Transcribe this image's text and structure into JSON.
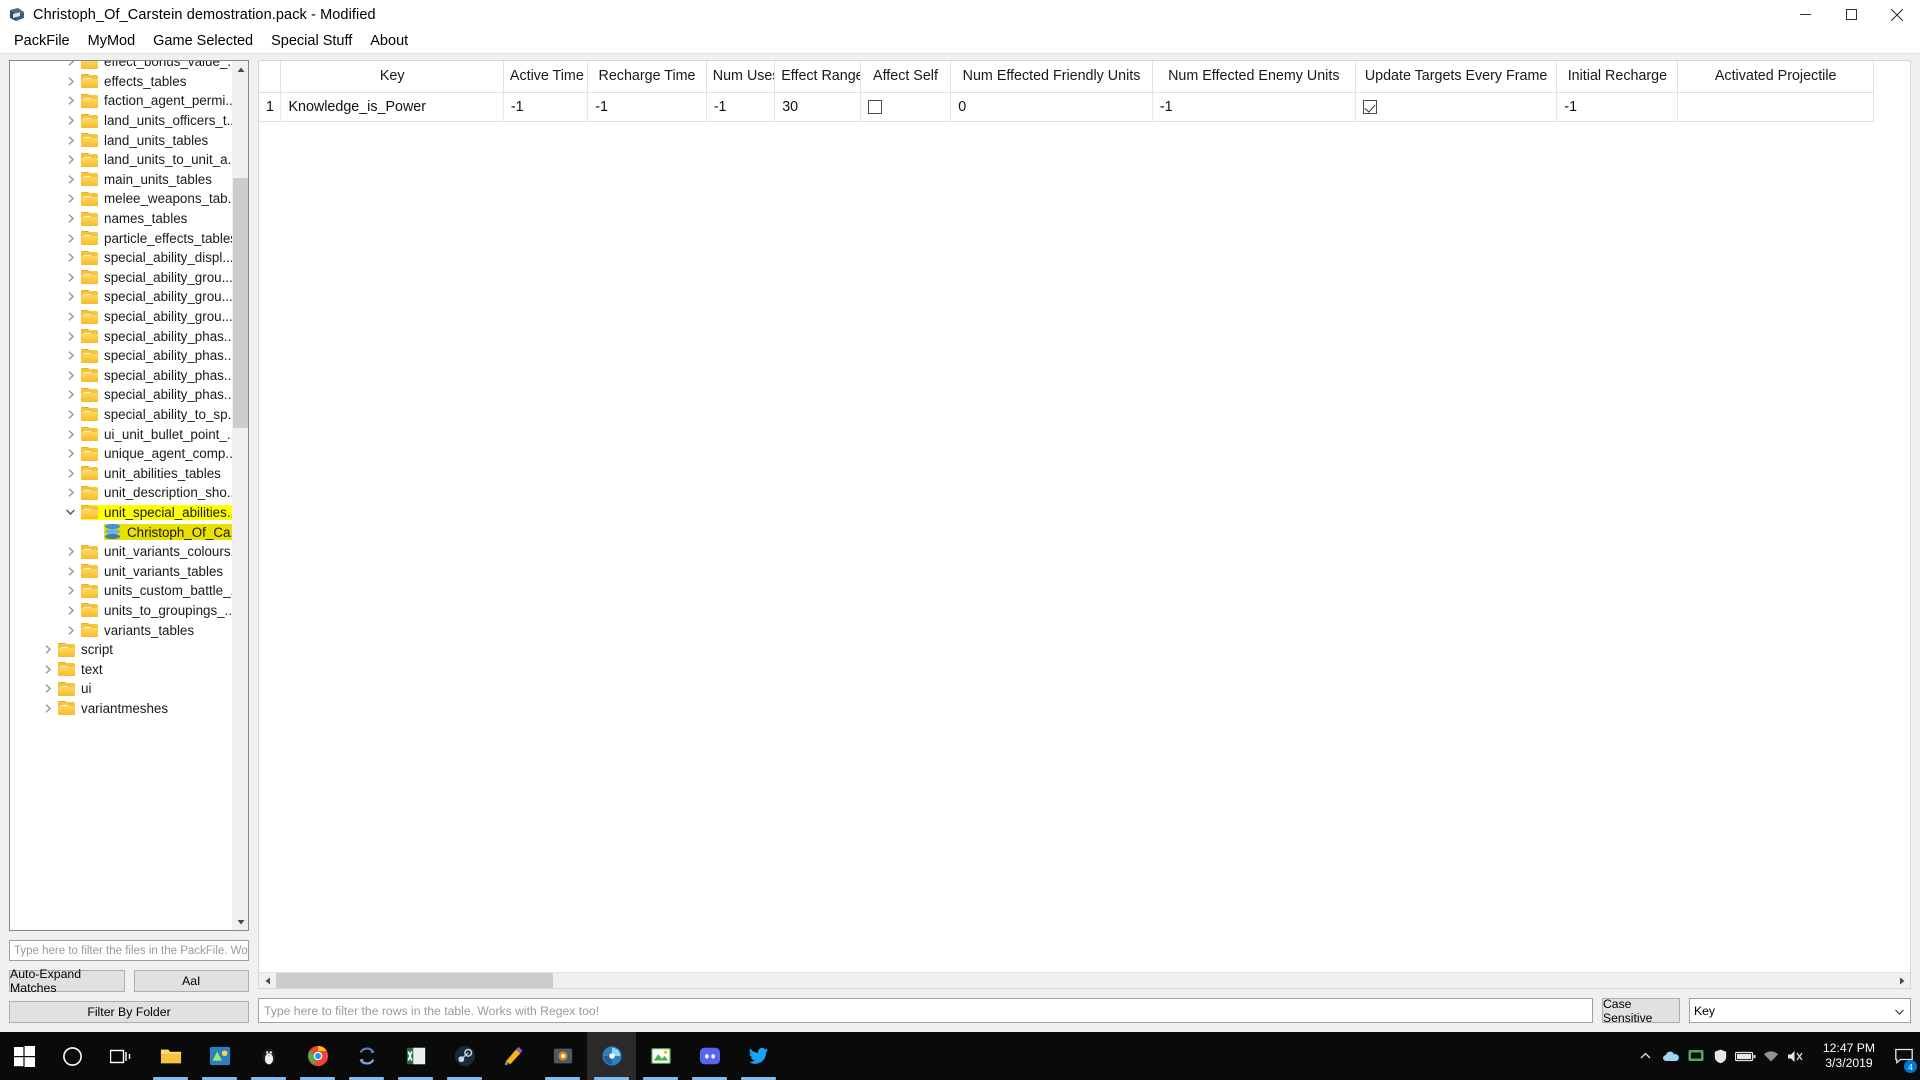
{
  "window": {
    "title": "Christoph_Of_Carstein demostration.pack - Modified",
    "icon": "packfile-manager-icon",
    "controls": {
      "minimize": "minimize-button",
      "maximize": "maximize-button",
      "close": "close-button"
    }
  },
  "menubar": {
    "items": [
      {
        "label": "PackFile"
      },
      {
        "label": "MyMod"
      },
      {
        "label": "Game Selected"
      },
      {
        "label": "Special Stuff"
      },
      {
        "label": "About"
      }
    ]
  },
  "tree": {
    "items": [
      {
        "label": "effect_bonus_value_...",
        "type": "folder",
        "indent": 1,
        "expander": "collapsed",
        "state": "normal"
      },
      {
        "label": "effects_tables",
        "type": "folder",
        "indent": 1,
        "expander": "collapsed",
        "state": "normal"
      },
      {
        "label": "faction_agent_permi...",
        "type": "folder",
        "indent": 1,
        "expander": "collapsed",
        "state": "normal"
      },
      {
        "label": "land_units_officers_t...",
        "type": "folder",
        "indent": 1,
        "expander": "collapsed",
        "state": "normal"
      },
      {
        "label": "land_units_tables",
        "type": "folder",
        "indent": 1,
        "expander": "collapsed",
        "state": "normal"
      },
      {
        "label": "land_units_to_unit_a...",
        "type": "folder",
        "indent": 1,
        "expander": "collapsed",
        "state": "normal"
      },
      {
        "label": "main_units_tables",
        "type": "folder",
        "indent": 1,
        "expander": "collapsed",
        "state": "normal"
      },
      {
        "label": "melee_weapons_tab...",
        "type": "folder",
        "indent": 1,
        "expander": "collapsed",
        "state": "normal"
      },
      {
        "label": "names_tables",
        "type": "folder",
        "indent": 1,
        "expander": "collapsed",
        "state": "normal"
      },
      {
        "label": "particle_effects_tables",
        "type": "folder",
        "indent": 1,
        "expander": "collapsed",
        "state": "normal"
      },
      {
        "label": "special_ability_displ...",
        "type": "folder",
        "indent": 1,
        "expander": "collapsed",
        "state": "normal"
      },
      {
        "label": "special_ability_grou...",
        "type": "folder",
        "indent": 1,
        "expander": "collapsed",
        "state": "normal"
      },
      {
        "label": "special_ability_grou...",
        "type": "folder",
        "indent": 1,
        "expander": "collapsed",
        "state": "normal"
      },
      {
        "label": "special_ability_grou...",
        "type": "folder",
        "indent": 1,
        "expander": "collapsed",
        "state": "normal"
      },
      {
        "label": "special_ability_phas...",
        "type": "folder",
        "indent": 1,
        "expander": "collapsed",
        "state": "normal"
      },
      {
        "label": "special_ability_phas...",
        "type": "folder",
        "indent": 1,
        "expander": "collapsed",
        "state": "normal"
      },
      {
        "label": "special_ability_phas...",
        "type": "folder",
        "indent": 1,
        "expander": "collapsed",
        "state": "normal"
      },
      {
        "label": "special_ability_phas...",
        "type": "folder",
        "indent": 1,
        "expander": "collapsed",
        "state": "normal"
      },
      {
        "label": "special_ability_to_sp...",
        "type": "folder",
        "indent": 1,
        "expander": "collapsed",
        "state": "normal"
      },
      {
        "label": "ui_unit_bullet_point_...",
        "type": "folder",
        "indent": 1,
        "expander": "collapsed",
        "state": "normal"
      },
      {
        "label": "unique_agent_comp...",
        "type": "folder",
        "indent": 1,
        "expander": "collapsed",
        "state": "normal"
      },
      {
        "label": "unit_abilities_tables",
        "type": "folder",
        "indent": 1,
        "expander": "collapsed",
        "state": "normal"
      },
      {
        "label": "unit_description_sho...",
        "type": "folder",
        "indent": 1,
        "expander": "collapsed",
        "state": "normal"
      },
      {
        "label": "unit_special_abilities...",
        "type": "folder",
        "indent": 1,
        "expander": "expanded",
        "state": "highlighted"
      },
      {
        "label": "Christoph_Of_Ca...",
        "type": "db",
        "indent": 2,
        "expander": "none",
        "state": "selected"
      },
      {
        "label": "unit_variants_colours...",
        "type": "folder",
        "indent": 1,
        "expander": "collapsed",
        "state": "normal"
      },
      {
        "label": "unit_variants_tables",
        "type": "folder",
        "indent": 1,
        "expander": "collapsed",
        "state": "normal"
      },
      {
        "label": "units_custom_battle_...",
        "type": "folder",
        "indent": 1,
        "expander": "collapsed",
        "state": "normal"
      },
      {
        "label": "units_to_groupings_...",
        "type": "folder",
        "indent": 1,
        "expander": "collapsed",
        "state": "normal"
      },
      {
        "label": "variants_tables",
        "type": "folder",
        "indent": 1,
        "expander": "collapsed",
        "state": "normal"
      },
      {
        "label": "script",
        "type": "folder",
        "indent": 0,
        "expander": "collapsed",
        "state": "normal"
      },
      {
        "label": "text",
        "type": "folder",
        "indent": 0,
        "expander": "collapsed",
        "state": "normal"
      },
      {
        "label": "ui",
        "type": "folder",
        "indent": 0,
        "expander": "collapsed",
        "state": "normal"
      },
      {
        "label": "variantmeshes",
        "type": "folder",
        "indent": 0,
        "expander": "collapsed",
        "state": "normal"
      }
    ]
  },
  "sidebar_controls": {
    "filter_placeholder": "Type here to filter the files in the PackFile. Works with ...",
    "filter_value": "",
    "auto_expand_label": "Auto-Expand Matches",
    "case_label": "AaI",
    "filter_by_folder_label": "Filter By Folder"
  },
  "table": {
    "columns": [
      "Key",
      "Active Time",
      "Recharge Time",
      "Num Uses",
      "Effect Range",
      "Affect Self",
      "Num Effected Friendly Units",
      "Num Effected Enemy Units",
      "Update Targets Every Frame",
      "Initial Recharge",
      "Activated Projectile"
    ],
    "rows": [
      {
        "number": "1",
        "cells": [
          {
            "type": "text",
            "value": "Knowledge_is_Power"
          },
          {
            "type": "text",
            "value": "-1"
          },
          {
            "type": "text",
            "value": "-1"
          },
          {
            "type": "text",
            "value": "-1"
          },
          {
            "type": "text",
            "value": "30"
          },
          {
            "type": "checkbox",
            "value": false
          },
          {
            "type": "text",
            "value": "0"
          },
          {
            "type": "text",
            "value": "-1"
          },
          {
            "type": "checkbox",
            "value": true
          },
          {
            "type": "text",
            "value": "-1"
          },
          {
            "type": "text",
            "value": ""
          }
        ]
      }
    ]
  },
  "table_footer": {
    "row_filter_placeholder": "Type here to filter the rows in the table. Works with Regex too!",
    "row_filter_value": "",
    "case_sensitive_label": "Case Sensitive",
    "column_select_value": "Key"
  },
  "taskbar": {
    "start": "windows-start-icon",
    "search": "cortana-search-icon",
    "taskview": "task-view-icon",
    "apps": [
      {
        "name": "file-explorer",
        "running": true,
        "active": false
      },
      {
        "name": "rpfm-app",
        "running": true,
        "active": false
      },
      {
        "name": "penguin-app",
        "running": true,
        "active": false
      },
      {
        "name": "google-chrome",
        "running": true,
        "active": false
      },
      {
        "name": "sync-app",
        "running": true,
        "active": false
      },
      {
        "name": "excel",
        "running": true,
        "active": false
      },
      {
        "name": "steam",
        "running": true,
        "active": false
      },
      {
        "name": "paint-app",
        "running": false,
        "active": false
      },
      {
        "name": "blender-app",
        "running": true,
        "active": false
      },
      {
        "name": "rpfm-packfile-manager",
        "running": true,
        "active": true
      },
      {
        "name": "photo-editor",
        "running": true,
        "active": false
      },
      {
        "name": "discord",
        "running": true,
        "active": false
      },
      {
        "name": "twitter-app",
        "running": true,
        "active": false
      }
    ],
    "tray": [
      {
        "name": "show-hidden-icons"
      },
      {
        "name": "onedrive-icon"
      },
      {
        "name": "nvidia-icon"
      },
      {
        "name": "shield-icon"
      },
      {
        "name": "battery-icon"
      },
      {
        "name": "wifi-icon"
      },
      {
        "name": "volume-icon"
      }
    ],
    "clock": {
      "time": "12:47 PM",
      "date": "3/3/2019"
    },
    "notification_count": "4"
  }
}
